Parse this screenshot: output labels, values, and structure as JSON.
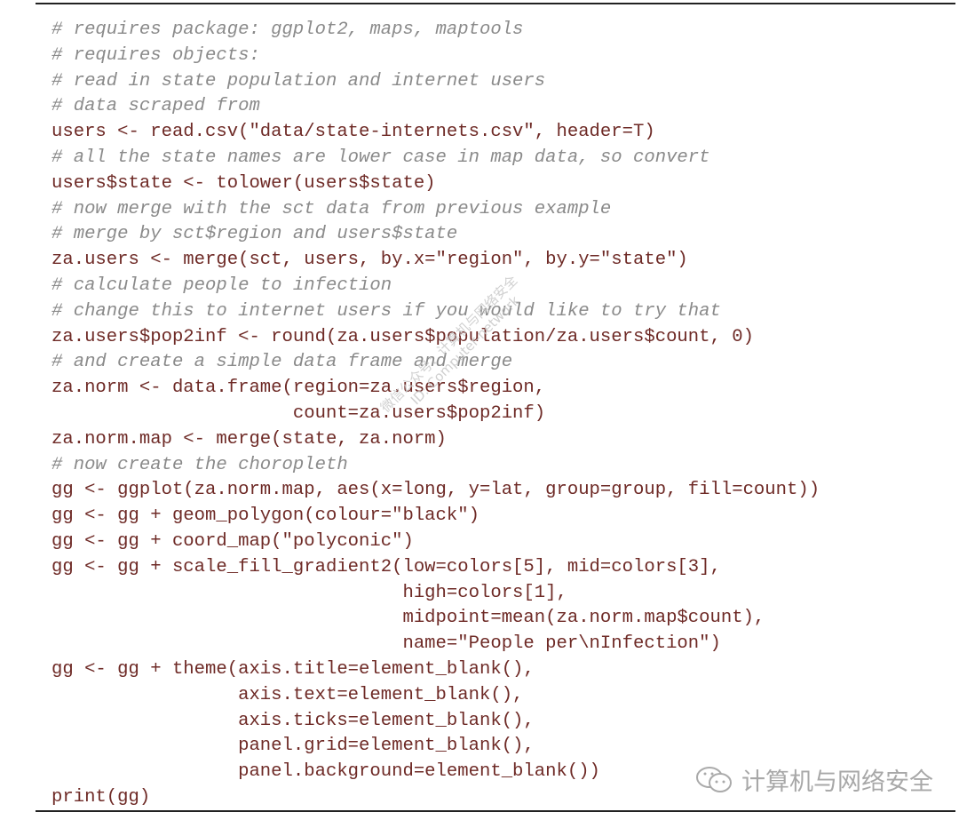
{
  "code_lines": [
    {
      "type": "comment",
      "text": "# requires package: ggplot2, maps, maptools"
    },
    {
      "type": "comment",
      "text": "# requires objects:"
    },
    {
      "type": "comment",
      "text": "# read in state population and internet users"
    },
    {
      "type": "comment",
      "text": "# data scraped from"
    },
    {
      "type": "code",
      "text": "users <- read.csv(\"data/state-internets.csv\", header=T)"
    },
    {
      "type": "comment",
      "text": "# all the state names are lower case in map data, so convert"
    },
    {
      "type": "code",
      "text": "users$state <- tolower(users$state)"
    },
    {
      "type": "comment",
      "text": "# now merge with the sct data from previous example"
    },
    {
      "type": "comment",
      "text": "# merge by sct$region and users$state"
    },
    {
      "type": "code",
      "text": "za.users <- merge(sct, users, by.x=\"region\", by.y=\"state\")"
    },
    {
      "type": "comment",
      "text": "# calculate people to infection"
    },
    {
      "type": "comment",
      "text": "# change this to internet users if you would like to try that"
    },
    {
      "type": "code",
      "text": "za.users$pop2inf <- round(za.users$population/za.users$count, 0)"
    },
    {
      "type": "comment",
      "text": "# and create a simple data frame and merge"
    },
    {
      "type": "code",
      "text": "za.norm <- data.frame(region=za.users$region,"
    },
    {
      "type": "code",
      "text": "                      count=za.users$pop2inf)"
    },
    {
      "type": "code",
      "text": "za.norm.map <- merge(state, za.norm)"
    },
    {
      "type": "comment",
      "text": "# now create the choropleth"
    },
    {
      "type": "code",
      "text": "gg <- ggplot(za.norm.map, aes(x=long, y=lat, group=group, fill=count))"
    },
    {
      "type": "code",
      "text": "gg <- gg + geom_polygon(colour=\"black\")"
    },
    {
      "type": "code",
      "text": "gg <- gg + coord_map(\"polyconic\")"
    },
    {
      "type": "code",
      "text": "gg <- gg + scale_fill_gradient2(low=colors[5], mid=colors[3],"
    },
    {
      "type": "code",
      "text": "                                high=colors[1],"
    },
    {
      "type": "code",
      "text": "                                midpoint=mean(za.norm.map$count),"
    },
    {
      "type": "code",
      "text": "                                name=\"People per\\nInfection\")"
    },
    {
      "type": "code",
      "text": "gg <- gg + theme(axis.title=element_blank(),"
    },
    {
      "type": "code",
      "text": "                 axis.text=element_blank(),"
    },
    {
      "type": "code",
      "text": "                 axis.ticks=element_blank(),"
    },
    {
      "type": "code",
      "text": "                 panel.grid=element_blank(),"
    },
    {
      "type": "code",
      "text": "                 panel.background=element_blank())"
    },
    {
      "type": "code",
      "text": "print(gg)"
    }
  ],
  "watermark": {
    "line1": "微信公众号：计算机与网络安全",
    "line2": "ID: Computer-network"
  },
  "footer_logo": {
    "icon": "wechat-icon",
    "text": "计算机与网络安全"
  },
  "colors": {
    "code": "#6e2a26",
    "comment": "#8a8a8a",
    "rule": "#222222"
  }
}
